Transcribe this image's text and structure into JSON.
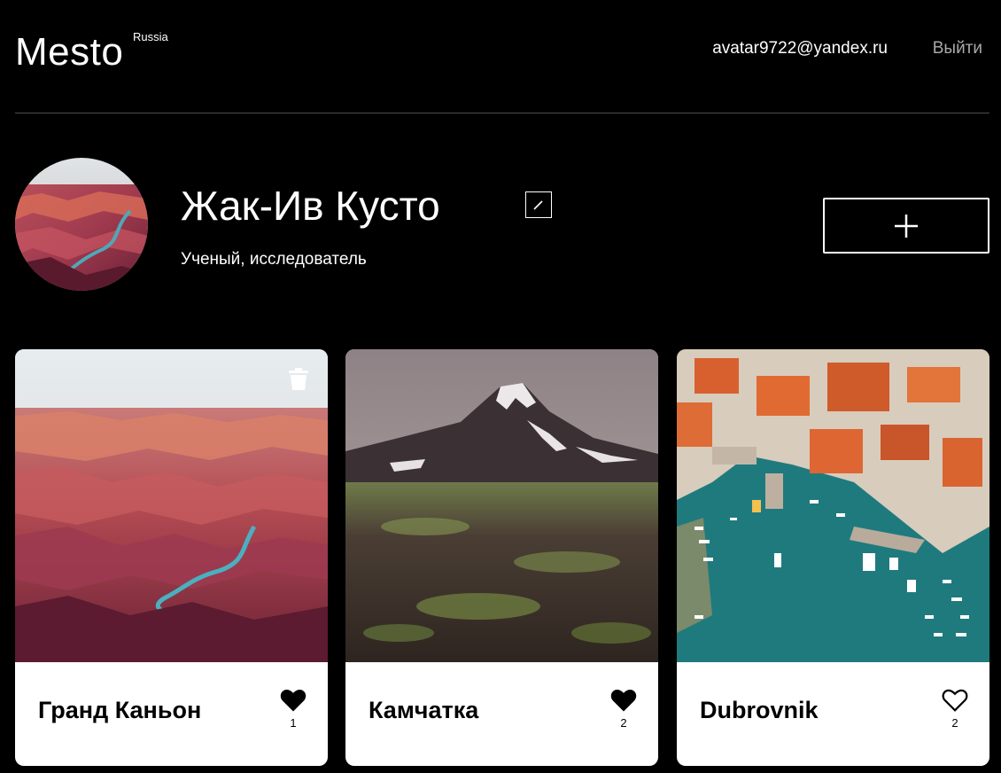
{
  "header": {
    "logo": "Mesto",
    "logo_sub": "Russia",
    "email": "avatar9722@yandex.ru",
    "logout_label": "Выйти"
  },
  "profile": {
    "name": "Жак-Ив Кусто",
    "about": "Ученый, исследователь",
    "edit_icon": "pencil-icon",
    "add_icon": "plus-icon"
  },
  "cards": [
    {
      "title": "Гранд Каньон",
      "likes": "1",
      "liked": true,
      "deletable": true,
      "image": "grand-canyon"
    },
    {
      "title": "Камчатка",
      "likes": "2",
      "liked": true,
      "deletable": false,
      "image": "kamchatka-volcano"
    },
    {
      "title": "Dubrovnik",
      "likes": "2",
      "liked": false,
      "deletable": false,
      "image": "dubrovnik-harbor"
    }
  ],
  "colors": {
    "background": "#000000",
    "card": "#ffffff",
    "logout": "#a9a9a9",
    "divider": "#545454"
  }
}
